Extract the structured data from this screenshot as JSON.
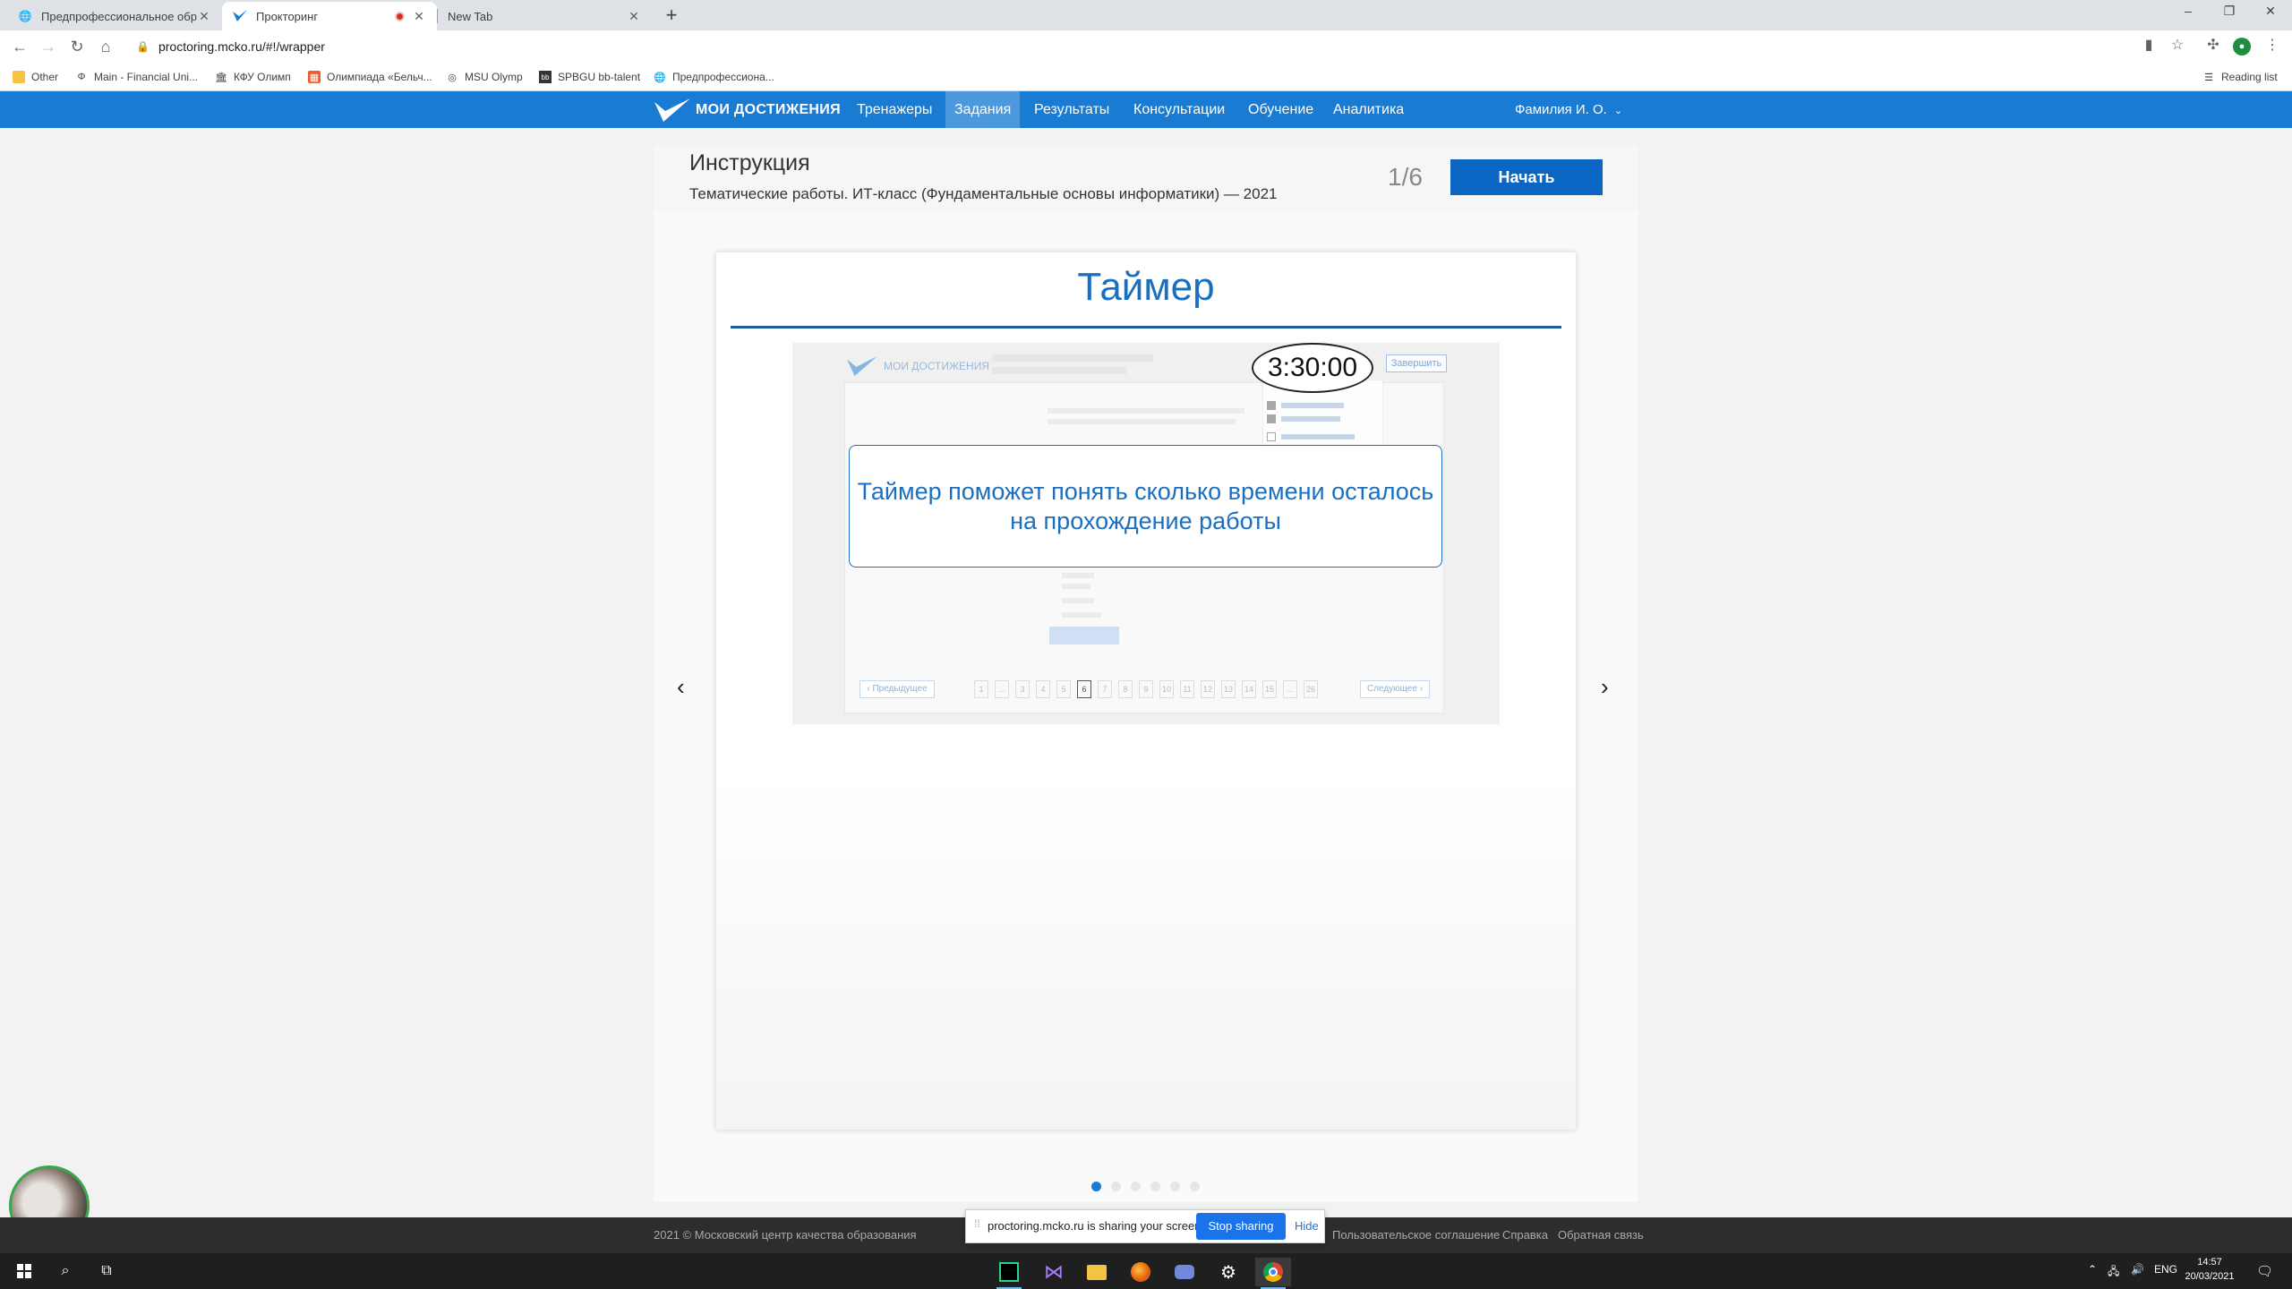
{
  "browser": {
    "tabs": [
      {
        "title": "Предпрофессиональное образ...",
        "active": false
      },
      {
        "title": "Прокторинг",
        "active": true,
        "recording": true
      },
      {
        "title": "New Tab",
        "active": false
      }
    ],
    "url": "proctoring.mcko.ru/#!/wrapper",
    "bookmarks": [
      {
        "label": "Other",
        "icon": "folder-icon"
      },
      {
        "label": "Main - Financial Uni...",
        "icon": "phi-icon"
      },
      {
        "label": "КФУ Олимп",
        "icon": "building-icon"
      },
      {
        "label": "Олимпиада «Бельч...",
        "icon": "grid-icon"
      },
      {
        "label": "MSU Olymp",
        "icon": "globe-icon"
      },
      {
        "label": "SPBGU bb-talent",
        "icon": "bb-icon"
      },
      {
        "label": "Предпрофессиона...",
        "icon": "globe-icon"
      }
    ],
    "reading_list": "Reading list"
  },
  "site": {
    "logo_text": "МОИ ДОСТИЖЕНИЯ",
    "nav": [
      {
        "label": "Тренажеры",
        "active": false
      },
      {
        "label": "Задания",
        "active": true
      },
      {
        "label": "Результаты",
        "active": false
      },
      {
        "label": "Консультации",
        "active": false
      },
      {
        "label": "Обучение",
        "active": false
      },
      {
        "label": "Аналитика",
        "active": false
      }
    ],
    "user_name": "Фамилия И. О.",
    "brand_color": "#1a7bd3"
  },
  "instruction": {
    "title": "Инструкция",
    "subtitle": "Тематические работы. ИТ-класс (Фундаментальные основы информатики) — 2021",
    "counter": "1/6",
    "start_label": "Начать"
  },
  "slide": {
    "title": "Таймер",
    "timer_value": "3:30:00",
    "callout": "Таймер поможет понять сколько времени осталось на прохождение работы",
    "mock_logo": "МОИ ДОСТИЖЕНИЯ",
    "mock_finish": "Завершить",
    "mock_prev": "Предыдущее",
    "mock_next": "Следующее",
    "mock_pages": [
      "1",
      "...",
      "3",
      "4",
      "5",
      "6",
      "7",
      "8",
      "9",
      "10",
      "11",
      "12",
      "13",
      "14",
      "15",
      "...",
      "26"
    ],
    "mock_current_page": "6",
    "total_slides": 6,
    "active_slide": 1
  },
  "footer": {
    "copyright": "2021 © Московский центр качества образования",
    "links": [
      "Пользовательское соглашение",
      "Справка",
      "Обратная связь"
    ]
  },
  "share_bar": {
    "text": "proctoring.mcko.ru is sharing your screen.",
    "stop_label": "Stop sharing",
    "hide_label": "Hide"
  },
  "taskbar": {
    "lang": "ENG",
    "time": "14:57",
    "date": "20/03/2021"
  }
}
